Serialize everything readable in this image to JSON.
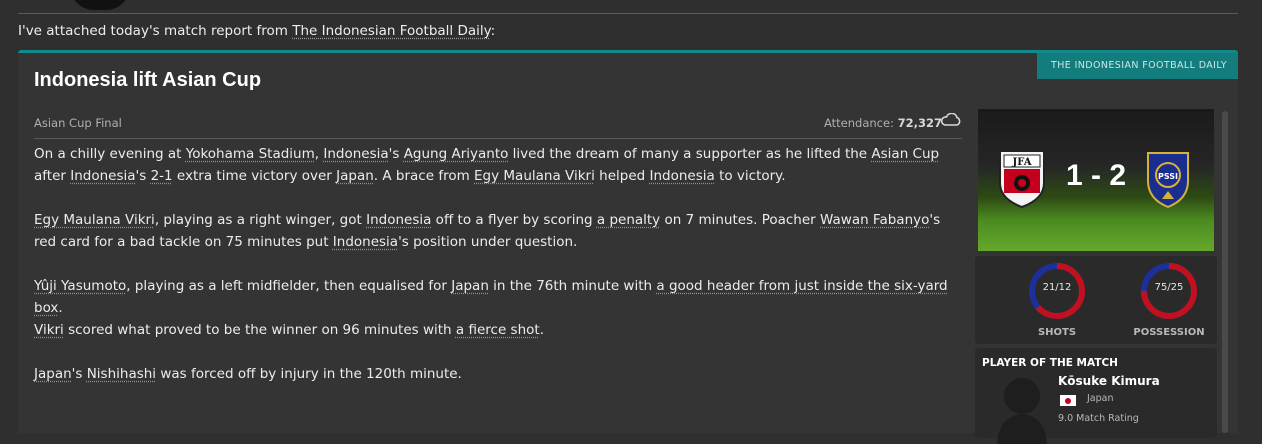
{
  "intro": {
    "prefix": "I've attached today's match report from ",
    "source": "The Indonesian Football Daily",
    "suffix": ":"
  },
  "card": {
    "tag": "THE INDONESIAN FOOTBALL DAILY",
    "headline": "Indonesia lift Asian Cup",
    "competition": "Asian Cup Final",
    "attendance_label": "Attendance:",
    "attendance_value": "72,327",
    "weather_icon": "cloud-icon"
  },
  "article": {
    "p1": {
      "a": "On a chilly evening at ",
      "b": "Yokohama Stadium",
      "c": ", ",
      "d": "Indonesia",
      "e": "'s ",
      "f": "Agung Ariyanto",
      "g": " lived the dream of many a supporter as he lifted the ",
      "h": "Asian Cup",
      "i": " after ",
      "j": "Indonesia",
      "k": "'s ",
      "l": "2-1",
      "m": " extra time victory over ",
      "n": "Japan",
      "o": ". A brace from ",
      "p": "Egy Maulana Vikri",
      "q": " helped ",
      "r": "Indonesia",
      "s": " to victory."
    },
    "p2": {
      "a": "Egy Maulana Vikri",
      "b": ", playing as a right winger, got ",
      "c": "Indonesia",
      "d": " off to a flyer by scoring ",
      "e": "a penalty",
      "f": " on 7 minutes. Poacher ",
      "g": "Wawan Fabanyo",
      "h": "'s red card for a bad tackle on 75 minutes put ",
      "i": "Indonesia",
      "j": "'s position under question."
    },
    "p3": {
      "a": "Yûji Yasumoto",
      "b": ", playing as a left midfielder, then equalised for ",
      "c": "Japan",
      "d": " in the 76th minute with ",
      "e": "a good header from just inside the six-yard box",
      "f": ".",
      "g": "Vikri",
      "h": " scored what proved to be the winner on 96 minutes with ",
      "i": "a fierce shot",
      "j": "."
    },
    "p4": {
      "a": "Japan",
      "b": "'s ",
      "c": "Nishihashi",
      "d": " was forced off by injury in the 120th minute."
    }
  },
  "scoreboard": {
    "score": "1 - 2",
    "home_crest": "jfa-crest-icon",
    "away_crest": "pssi-crest-icon"
  },
  "stats": {
    "shots": {
      "label": "SHOTS",
      "value": "21/12",
      "home": 21,
      "away": 12
    },
    "possession": {
      "label": "POSSESSION",
      "value": "75/25",
      "home": 75,
      "away": 25
    },
    "colors": {
      "home": "#c0111f",
      "away": "#1d2f9a"
    }
  },
  "potm": {
    "title": "PLAYER OF THE MATCH",
    "name": "Kōsuke Kimura",
    "nation": "Japan",
    "rating_text": "9.0   Match Rating"
  }
}
